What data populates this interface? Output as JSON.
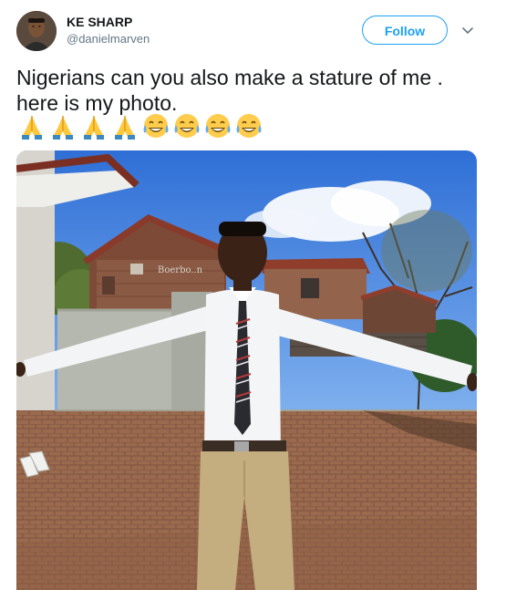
{
  "tweet": {
    "author_name": "KE SHARP",
    "author_handle": "@danielmarven",
    "follow_label": "Follow",
    "text_line1": "Nigerians can you also make a stature of me .",
    "text_line2": "here is my photo.",
    "emojis": [
      "folded-hands",
      "folded-hands",
      "folded-hands",
      "folded-hands",
      "tears-of-joy",
      "tears-of-joy",
      "tears-of-joy",
      "tears-of-joy"
    ]
  },
  "photo": {
    "sign_text": "Boerbo..n"
  },
  "colors": {
    "accent": "#1da1f2",
    "text": "#14171a",
    "secondary": "#657786"
  }
}
